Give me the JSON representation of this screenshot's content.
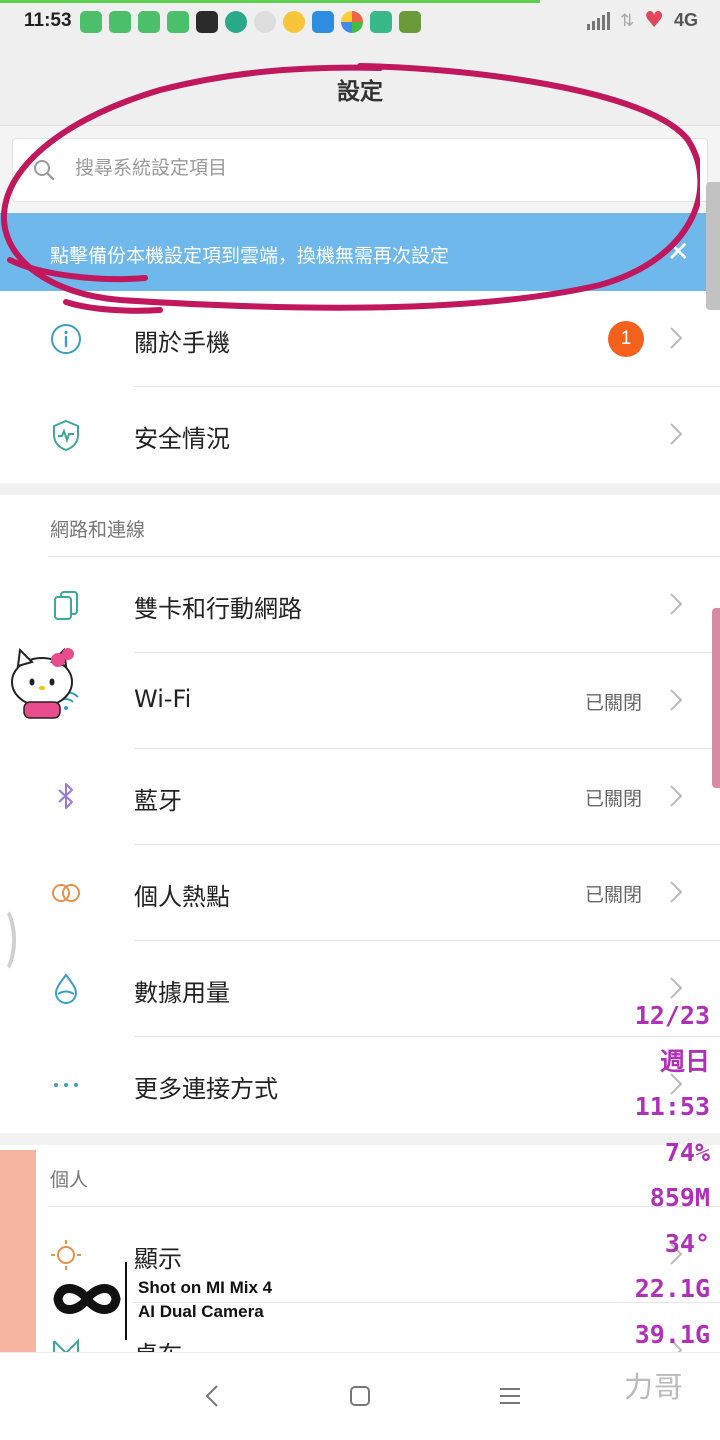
{
  "status_bar": {
    "time": "11:53",
    "network": "4G"
  },
  "header": {
    "title": "設定"
  },
  "search": {
    "placeholder": "搜尋系統設定項目"
  },
  "banner": {
    "text": "點擊備份本機設定項到雲端，換機無需再次設定",
    "close": "✕"
  },
  "group1": {
    "items": [
      {
        "label": "關於手機",
        "badge": "1"
      },
      {
        "label": "安全情況"
      }
    ]
  },
  "network": {
    "section_title": "網路和連線",
    "items": [
      {
        "label": "雙卡和行動網路",
        "status": ""
      },
      {
        "label": "Wi-Fi",
        "status": "已關閉"
      },
      {
        "label": "藍牙",
        "status": "已關閉"
      },
      {
        "label": "個人熱點",
        "status": "已關閉"
      },
      {
        "label": "數據用量",
        "status": ""
      },
      {
        "label": "更多連接方式",
        "status": ""
      }
    ]
  },
  "personal": {
    "section_title": "個人",
    "items": [
      {
        "label": "顯示"
      },
      {
        "label": "桌布"
      }
    ]
  },
  "widget": {
    "date": "12/23",
    "weekday": "週日",
    "time": "11:53",
    "battery": "74%",
    "memory": "859M",
    "temp": "34°",
    "storage1": "22.1G",
    "storage2": "39.1G"
  },
  "watermark": {
    "line1": "Shot on MI Mix 4",
    "line2": "AI Dual Camera"
  },
  "signature": "力哥",
  "colors": {
    "accent_blue": "#6fb8eb",
    "badge": "#f4611c",
    "annotation": "#c0175d",
    "widget_text": "#b030b8",
    "icon_teal": "#3aa89c"
  }
}
